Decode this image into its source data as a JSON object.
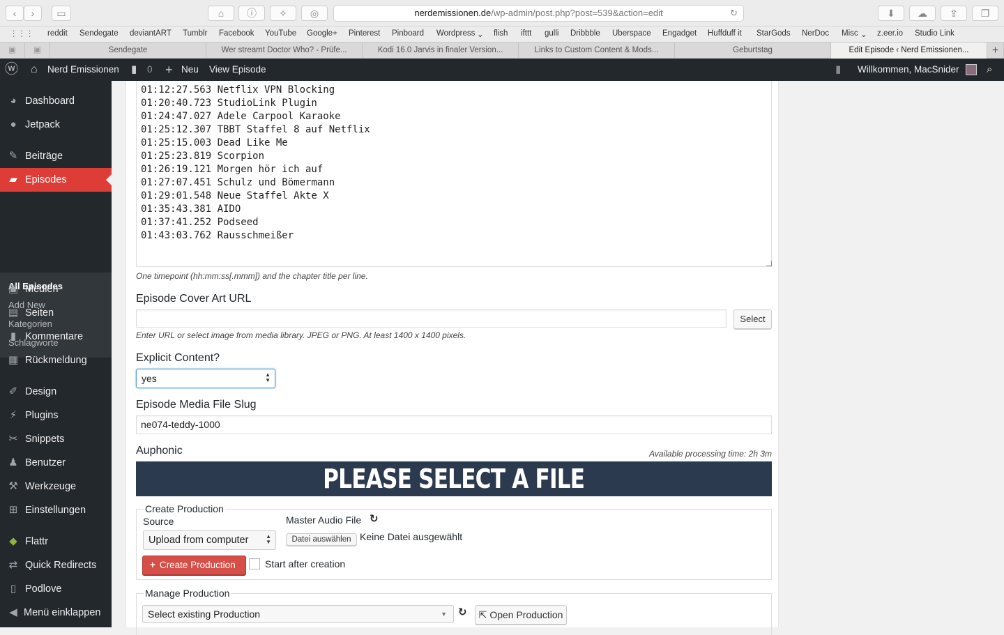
{
  "browser": {
    "url_domain": "nerdemissionen.de",
    "url_path": "/wp-admin/post.php?post=539&action=edit",
    "bookmarks": [
      "reddit",
      "Sendegate",
      "deviantART",
      "Tumblr",
      "Facebook",
      "YouTube",
      "Google+",
      "Pinterest",
      "Pinboard",
      "Wordpress",
      "flish",
      "ifttt",
      "gulli",
      "Dribbble",
      "Uberspace",
      "Engadget",
      "Huffduff it",
      "StarGods",
      "NerDoc",
      "Misc",
      "z.eer.io",
      "Studio Link"
    ],
    "tabs": [
      "Sendegate",
      "Wer streamt Doctor Who? - Prüfe...",
      "Kodi 16.0 Jarvis in finaler Version...",
      "Links to Custom Content & Mods...",
      "Geburtstag",
      "Edit Episode ‹ Nerd Emissionen..."
    ]
  },
  "admin_bar": {
    "site_name": "Nerd Emissionen",
    "comment_count": "0",
    "new_label": "Neu",
    "view_label": "View Episode",
    "welcome": "Willkommen, MacSnider"
  },
  "sidebar": {
    "items": [
      {
        "label": "Dashboard",
        "icon": "dashboard-icon"
      },
      {
        "label": "Jetpack",
        "icon": "jetpack-icon"
      },
      {
        "label": "Beiträge",
        "icon": "pin-icon"
      },
      {
        "label": "Episodes",
        "icon": "clapperboard-icon"
      },
      {
        "label": "Medien",
        "icon": "media-icon"
      },
      {
        "label": "Seiten",
        "icon": "pages-icon"
      },
      {
        "label": "Kommentare",
        "icon": "comment-icon"
      },
      {
        "label": "Rückmeldung",
        "icon": "feedback-icon"
      },
      {
        "label": "Design",
        "icon": "brush-icon"
      },
      {
        "label": "Plugins",
        "icon": "plugin-icon"
      },
      {
        "label": "Snippets",
        "icon": "scissors-icon"
      },
      {
        "label": "Benutzer",
        "icon": "user-icon"
      },
      {
        "label": "Werkzeuge",
        "icon": "wrench-icon"
      },
      {
        "label": "Einstellungen",
        "icon": "settings-icon"
      },
      {
        "label": "Flattr",
        "icon": "flattr-icon"
      },
      {
        "label": "Quick Redirects",
        "icon": "redirect-icon"
      },
      {
        "label": "Podlove",
        "icon": "podlove-icon"
      },
      {
        "label": "Menü einklappen",
        "icon": "collapse-icon"
      }
    ],
    "submenu": [
      "All Episodes",
      "Add New",
      "Kategorien",
      "Schlagworte"
    ]
  },
  "chapters": {
    "text": "01:12:27.563 Netflix VPN Blocking\n01:20:40.723 StudioLink Plugin\n01:24:47.027 Adele Carpool Karaoke\n01:25:12.307 TBBT Staffel 8 auf Netflix\n01:25:15.003 Dead Like Me\n01:25:23.819 Scorpion\n01:26:19.121 Morgen hör ich auf\n01:27:07.451 Schulz und Bömermann\n01:29:01.548 Neue Staffel Akte X\n01:35:43.381 AIDO\n01:37:41.252 Podseed\n01:43:03.762 Rausschmeißer",
    "hint": "One timepoint (hh:mm:ss[.mmm]) and the chapter title per line."
  },
  "cover_art": {
    "label": "Episode Cover Art URL",
    "value": "",
    "select_label": "Select",
    "hint": "Enter URL or select image from media library. JPEG or PNG. At least 1400 x 1400 pixels."
  },
  "explicit": {
    "label": "Explicit Content?",
    "value": "yes"
  },
  "slug": {
    "label": "Episode Media File Slug",
    "value": "ne074-teddy-1000"
  },
  "auphonic": {
    "title": "Auphonic",
    "processing_time": "Available processing time: 2h 3m",
    "banner": "PLEASE SELECT A FILE",
    "create": {
      "legend": "Create Production",
      "source_label": "Source",
      "source_value": "Upload from computer",
      "master_label": "Master Audio File",
      "file_button": "Datei auswählen",
      "file_status": "Keine Datei ausgewählt",
      "create_button": "Create Production",
      "start_after": "Start after creation"
    },
    "manage": {
      "legend": "Manage Production",
      "select_value": "Select existing Production",
      "open_button": "Open Production"
    }
  }
}
